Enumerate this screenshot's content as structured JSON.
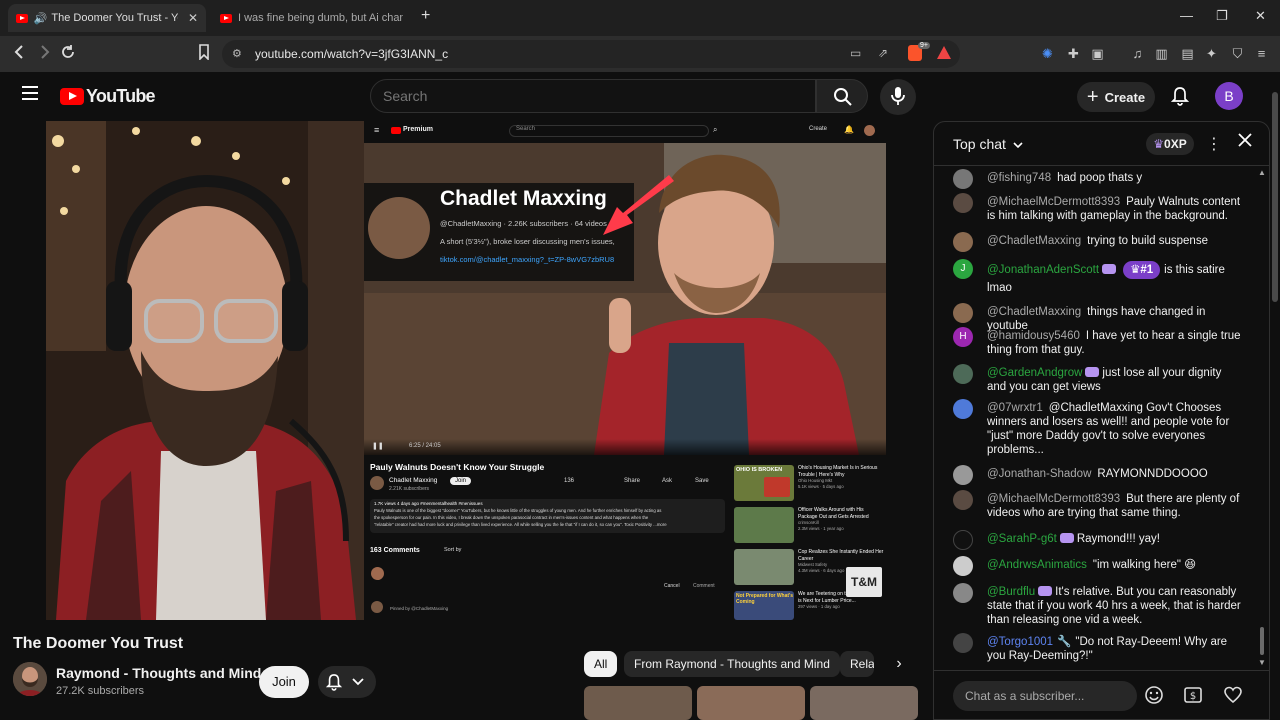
{
  "browser": {
    "tabs": [
      {
        "title": "The Doomer You Trust - YouTube",
        "active": true
      },
      {
        "title": "I was fine being dumb, but Ai changed",
        "active": false
      }
    ],
    "url": "youtube.com/watch?v=3jfG3IANN_c",
    "extension_badge": "9+"
  },
  "youtube": {
    "logo_text": "YouTube",
    "search_placeholder": "Search",
    "create_label": "Create",
    "account_initial": "B"
  },
  "inner_video": {
    "premium_label": "Premium",
    "search_placeholder": "Search",
    "create_label": "Create",
    "channel_title": "Chadlet Maxxing",
    "channel_handle": "@ChadletMaxxing · 2.26K subscribers · 64 videos",
    "channel_desc": "A short (5'3½\"), broke loser discussing men's issues,",
    "channel_link": "tiktok.com/@chadlet_maxxing?_t=ZP-8wVG7zbRU8",
    "time": "6:25 / 24:05",
    "video_title": "Pauly Walnuts Doesn't Know Your Struggle",
    "uploader": "Chadlet Maxxing",
    "uploader_subs": "2.21K subscribers",
    "join_label": "Join",
    "likes": "136",
    "share_label": "Share",
    "ask_label": "Ask",
    "save_label": "Save",
    "views_meta": "1.7K views  4 days ago  #menmentalhealth #menissues",
    "desc_line1": "Pauly Walnuts is one of the biggest \"doomer\" YouTubers, but he knows little of the struggles of young men. And he further enriches himself by acting as",
    "desc_line2": "the spokesperson for our pain. In this video, I break down the unspoken parasocial contract in men's-issues content and what happens when the",
    "desc_line3": "\"relatable\" creator had had more luck and privilege than lived experience. All while selling you the lie that \"if I can do it, so can you\". Toxic Positivity ...more",
    "comments_count": "163 Comments",
    "sort_label": "Sort by",
    "cancel_label": "Cancel",
    "comment_label": "Comment",
    "pinned_label": "Pinned by @ChadletMaxxing",
    "recs": [
      {
        "title": "Ohio's Housing Market Is in Serious Trouble | Here's Why",
        "channel": "Ohio Housing Mkt",
        "meta": "5.1K views · 5 days ago",
        "thumb_text": "OHIO IS BROKEN"
      },
      {
        "title": "Officer Walks Around with His Package Out and Gets Arrested",
        "channel": "crimsonKill",
        "meta": "2.3M views · 1 year ago",
        "thumb_text": ""
      },
      {
        "title": "Cop Realizes She Instantly Ended Her Career",
        "channel": "Midwest Safety",
        "meta": "4.3M views · 6 days ago",
        "thumb_text": ""
      },
      {
        "title": "We are Teetering on the Edge - What is Next for Lumber Price...",
        "channel": "",
        "meta": "297 views · 1 day ago",
        "thumb_text": "Not Prepared for What's Coming"
      }
    ],
    "watermark": "T&M"
  },
  "video": {
    "title": "The Doomer You Trust",
    "channel": "Raymond - Thoughts and Mind",
    "subscribers": "27.2K subscribers",
    "join_label": "Join"
  },
  "chips": [
    "All",
    "From Raymond - Thoughts and Mind",
    "Rela"
  ],
  "chat": {
    "title": "Top chat",
    "xp_label": "0XP",
    "input_placeholder": "Chat as a subscriber...",
    "messages": [
      {
        "author": "@fishing748",
        "text": "had poop thats y",
        "type": "normal",
        "avatar": "#777777"
      },
      {
        "author": "@MichaelMcDermott8393",
        "text": "Pauly Walnuts content is him talking with gameplay in the background.",
        "type": "normal",
        "avatar": "#5a4b42"
      },
      {
        "author": "@ChadletMaxxing",
        "text": "trying to build suspense",
        "type": "normal",
        "avatar": "#8a6a50"
      },
      {
        "author": "@JonathanAdenScott",
        "text": "is this satire lmao",
        "gift": "#1",
        "type": "member",
        "avatar": "#2ba640",
        "initial": "J"
      },
      {
        "author": "@ChadletMaxxing",
        "text": "things have changed in youtube",
        "type": "normal",
        "avatar": "#8a6a50"
      },
      {
        "author": "@hamidousy5460",
        "text": "I have yet to hear a single true thing from that guy.",
        "type": "normal",
        "avatar": "#9c27b0",
        "initial": "H"
      },
      {
        "author": "@GardenAndgrow",
        "text": "just lose all your dignity and you can get views",
        "type": "member",
        "avatar": "#4d6a58"
      },
      {
        "author": "@07wrxtr1",
        "text": "@ChadletMaxxing Gov't Chooses winners and losers as well!! and people vote for \"just\" more Daddy gov't to solve everyones problems...",
        "type": "normal",
        "avatar": "#4f7ad9"
      },
      {
        "author": "@Jonathan-Shadow",
        "text": "RAYMONNDDOOOO",
        "type": "normal",
        "avatar": "#999999"
      },
      {
        "author": "@MichaelMcDermott8393",
        "text": "But there are plenty of videos who are trying that same thing.",
        "type": "normal",
        "avatar": "#5a4b42"
      },
      {
        "author": "@SarahP-g6t",
        "text": "Raymond!!! yay!",
        "type": "member",
        "avatar": "#111111"
      },
      {
        "author": "@AndrwsAnimatics",
        "text": "\"im walking here\" 😆",
        "type": "member",
        "avatar": "#cccccc"
      },
      {
        "author": "@Burdflu",
        "text": "It's relative. But you can reasonably state that if you work 40 hrs a week, that is harder than releasing one vid a week.",
        "type": "member",
        "avatar": "#888888"
      },
      {
        "author": "@Torgo1001",
        "text": "\"Do not Ray-Deeem! Why are you Ray-Deeming?!\"",
        "type": "moderator",
        "avatar": "#444444"
      }
    ]
  }
}
